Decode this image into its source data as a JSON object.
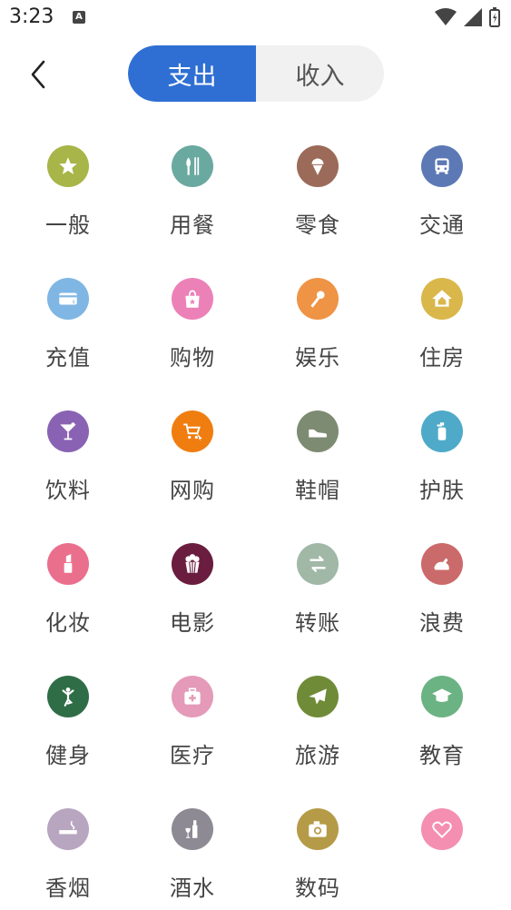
{
  "status_bar": {
    "time": "3:23",
    "a_badge": "A"
  },
  "header": {
    "tabs": [
      {
        "label": "支出",
        "active": true
      },
      {
        "label": "收入",
        "active": false
      }
    ]
  },
  "colors": {
    "accent": "#2f6fd3",
    "tab_bg": "#f1f1f1"
  },
  "categories": [
    {
      "label": "一般",
      "icon": "star-icon",
      "color": "#a8b548"
    },
    {
      "label": "用餐",
      "icon": "utensils-icon",
      "color": "#6aa9a0"
    },
    {
      "label": "零食",
      "icon": "ice-cream-icon",
      "color": "#9b6a58"
    },
    {
      "label": "交通",
      "icon": "bus-icon",
      "color": "#5c79b5"
    },
    {
      "label": "充值",
      "icon": "card-icon",
      "color": "#7fb6e3"
    },
    {
      "label": "购物",
      "icon": "shopping-bag-icon",
      "color": "#ec81b8"
    },
    {
      "label": "娱乐",
      "icon": "microphone-icon",
      "color": "#ef9344"
    },
    {
      "label": "住房",
      "icon": "house-icon",
      "color": "#d9b74a"
    },
    {
      "label": "饮料",
      "icon": "cocktail-icon",
      "color": "#8a62b3"
    },
    {
      "label": "网购",
      "icon": "cart-icon",
      "color": "#f07d10"
    },
    {
      "label": "鞋帽",
      "icon": "shoe-icon",
      "color": "#7d8b73"
    },
    {
      "label": "护肤",
      "icon": "bottle-icon",
      "color": "#4eaac8"
    },
    {
      "label": "化妆",
      "icon": "lipstick-icon",
      "color": "#ea6f8d"
    },
    {
      "label": "电影",
      "icon": "popcorn-icon",
      "color": "#6a1d3f"
    },
    {
      "label": "转账",
      "icon": "transfer-icon",
      "color": "#a1b8a7"
    },
    {
      "label": "浪费",
      "icon": "chicken-icon",
      "color": "#cb6a6a"
    },
    {
      "label": "健身",
      "icon": "yoga-icon",
      "color": "#2f6d46"
    },
    {
      "label": "医疗",
      "icon": "medical-kit-icon",
      "color": "#e49ab8"
    },
    {
      "label": "旅游",
      "icon": "airplane-icon",
      "color": "#6f8b37"
    },
    {
      "label": "教育",
      "icon": "graduation-cap-icon",
      "color": "#6bb383"
    },
    {
      "label": "香烟",
      "icon": "cigarette-icon",
      "color": "#b8a5bf"
    },
    {
      "label": "酒水",
      "icon": "wine-icon",
      "color": "#8d8a93"
    },
    {
      "label": "数码",
      "icon": "camera-icon",
      "color": "#b59a48"
    },
    {
      "label": "",
      "icon": "heart-icon",
      "color": "#f48fb1"
    }
  ]
}
